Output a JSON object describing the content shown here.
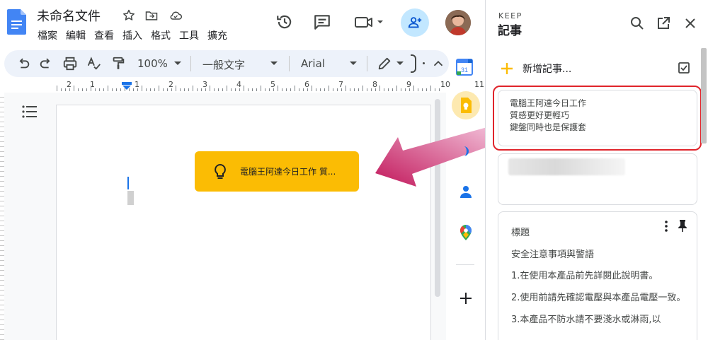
{
  "docs": {
    "title": "未命名文件",
    "menu": [
      "檔案",
      "編輯",
      "查看",
      "插入",
      "格式",
      "工具",
      "擴充"
    ]
  },
  "toolbar": {
    "zoom": "100%",
    "style": "一般文字",
    "font": "Arial"
  },
  "ruler": {
    "numbers": [
      "2",
      "1",
      "1",
      "2",
      "3",
      "4",
      "5",
      "6",
      "7",
      "8",
      "9",
      "10",
      "11"
    ]
  },
  "keep_chip": {
    "text": "電腦王阿達今日工作 質..."
  },
  "keep_panel": {
    "label": "KEEP",
    "title": "記事",
    "new_note": "新增記事...",
    "notes": [
      {
        "lines": [
          "電腦王阿達今日工作",
          "質感更好更輕巧",
          "鍵盤同時也是保護套"
        ]
      },
      {
        "title": "標題",
        "subtitle": "安全注意事項與警語",
        "items": [
          "1.在使用本產品前先詳閱此說明書。",
          "2.使用前請先確認電壓與本產品電壓一致。",
          "3.本產品不防水請不要淺水或淋雨,以"
        ]
      }
    ]
  },
  "colors": {
    "accent_blue": "#1a73e8",
    "keep_yellow": "#fbbc04",
    "highlight_red": "#e0242b",
    "arrow_magenta": "#c2185b"
  },
  "icons": {
    "docs": "docs-logo-icon",
    "history": "history-icon",
    "comments": "comment-icon",
    "meet": "video-camera-icon",
    "share": "add-person-icon",
    "keep": "lightbulb-icon"
  }
}
